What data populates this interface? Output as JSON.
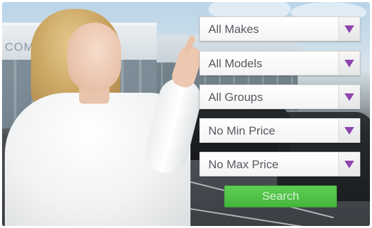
{
  "background": {
    "sign_text": "COM"
  },
  "search": {
    "makes": {
      "value": "All Makes"
    },
    "models": {
      "value": "All Models"
    },
    "groups": {
      "value": "All Groups"
    },
    "min_price": {
      "value": "No Min Price"
    },
    "max_price": {
      "value": "No Max Price"
    },
    "button_label": "Search"
  },
  "colors": {
    "dropdown_arrow": "#8e44ad",
    "search_button": "#4fc346"
  },
  "icons": {
    "dropdown_arrow": "chevron-down-icon"
  }
}
